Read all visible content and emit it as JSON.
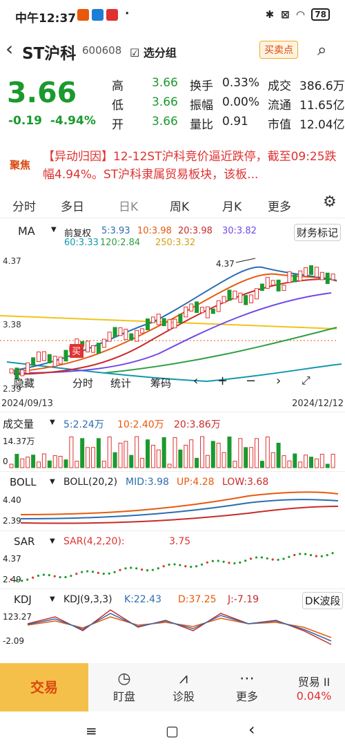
{
  "status": {
    "time": "中午12:37",
    "battery": "78",
    "dot": "·"
  },
  "header": {
    "back": "‹",
    "name": "ST沪科",
    "code": "600608",
    "watch_label": "选分组",
    "buy_sell": "买卖点",
    "search_icon": "search-icon"
  },
  "quote": {
    "price": "3.66",
    "change": "-0.19",
    "pct": "-4.94%",
    "grid": [
      {
        "k": "高",
        "v": "3.66",
        "k2": "换手",
        "v2": "0.33%",
        "k3": "成交",
        "v3": "386.6万"
      },
      {
        "k": "低",
        "v": "3.66",
        "k2": "振幅",
        "v2": "0.00%",
        "k3": "流通",
        "v3": "11.65亿"
      },
      {
        "k": "开",
        "v": "3.66",
        "k2": "量比",
        "v2": "0.91",
        "k3": "市值",
        "v3": "12.04亿"
      }
    ]
  },
  "news": {
    "tag": "聚焦",
    "text": "【异动归因】12-12ST沪科竞价逼近跌停，截至09:25跌幅4.94%。ST沪科隶属贸易板块，该板..."
  },
  "tabs": [
    "分时",
    "多日",
    "日K",
    "周K",
    "月K",
    "更多"
  ],
  "ma": {
    "name": "MA",
    "fq": "前复权",
    "l1": "5:3.93",
    "l2": "10:3.98",
    "l3": "20:3.98",
    "l4": "30:3.82",
    "l5": "60:3.33",
    "l6": "120:2.84",
    "l7": "250:3.32",
    "caiwu": "财务标记"
  },
  "chart": {
    "ymax": "4.37",
    "ymid": "3.38",
    "ymin": "2.39",
    "hi": "4.37",
    "buy": "买",
    "controls": [
      "隐藏",
      "分时",
      "统计",
      "筹码",
      "‹",
      "+",
      "−",
      "›"
    ]
  },
  "dates": {
    "start": "2024/09/13",
    "end": "2024/12/12"
  },
  "vol": {
    "name": "成交量",
    "v5": "5:2.24万",
    "v10": "10:2.40万",
    "v20": "20:3.86万",
    "ymax": "14.37万",
    "ymin": "0"
  },
  "boll": {
    "name": "BOLL",
    "p": "BOLL(20,2)",
    "mid": "MID:3.98",
    "up": "UP:4.28",
    "low": "LOW:3.68",
    "y1": "4.40",
    "y2": "2.39"
  },
  "sar": {
    "name": "SAR",
    "p": "SAR(4,2,20):",
    "v": "3.75",
    "y1": "4.37",
    "y2": "2.49"
  },
  "kdj": {
    "name": "KDJ",
    "p": "KDJ(9,3,3)",
    "k": "K:22.43",
    "d": "D:37.25",
    "j": "J:-7.19",
    "y1": "123.27",
    "y2": "-2.09",
    "dk": "DK波段"
  },
  "bottom": {
    "trade": "交易",
    "items": [
      "盯盘",
      "诊股",
      "更多"
    ],
    "yi": "贸易 II",
    "yi_pct": "0.04%"
  },
  "colors": {
    "up": "#e03131",
    "down": "#1a9a2e",
    "ma5": "#2b6cb0",
    "ma10": "#e8590c",
    "ma20": "#c92a2a",
    "ma30": "#7048e8",
    "ma60": "#1098ad",
    "ma120": "#2f9e44",
    "ma250": "#f0c419"
  }
}
